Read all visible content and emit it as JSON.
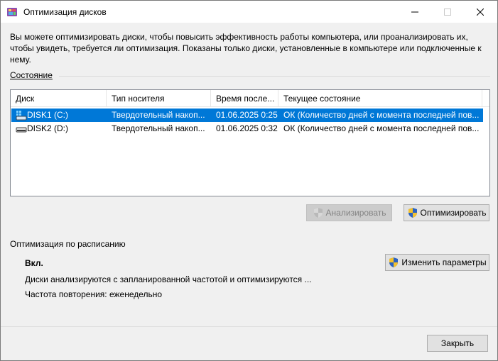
{
  "window": {
    "title": "Оптимизация дисков",
    "buttons": {
      "minimize": "minimize",
      "maximize": "maximize",
      "close": "close"
    }
  },
  "description": "Вы можете оптимизировать диски, чтобы повысить эффективность работы  компьютера, или проанализировать их, чтобы увидеть, требуется ли оптимизация. Показаны только диски, установленные в компьютере или подключенные к нему.",
  "status": {
    "label": "Состояние",
    "columns": [
      "Диск",
      "Тип носителя",
      "Время после...",
      "Текущее состояние"
    ],
    "rows": [
      {
        "drive": "DISK1 (C:)",
        "media": "Твердотельный накоп...",
        "last_run": "01.06.2025 0:25",
        "state": "ОК (Количество дней с момента последней пов...",
        "selected": true,
        "icon": "system-drive-icon"
      },
      {
        "drive": "DISK2 (D:)",
        "media": "Твердотельный накоп...",
        "last_run": "01.06.2025 0:32",
        "state": "ОК (Количество дней с момента последней пов...",
        "selected": false,
        "icon": "drive-icon"
      }
    ]
  },
  "actions": {
    "analyze": "Анализировать",
    "optimize": "Оптимизировать"
  },
  "schedule": {
    "title": "Оптимизация по расписанию",
    "state": "Вкл.",
    "description": "Диски анализируются с запланированной частотой и оптимизируются ...",
    "frequency": "Частота повторения: еженедельно",
    "change_button": "Изменить параметры"
  },
  "footer": {
    "close_button": "Закрыть"
  },
  "colors": {
    "selection": "#0078d7",
    "window_bg": "#f0f0f0"
  }
}
